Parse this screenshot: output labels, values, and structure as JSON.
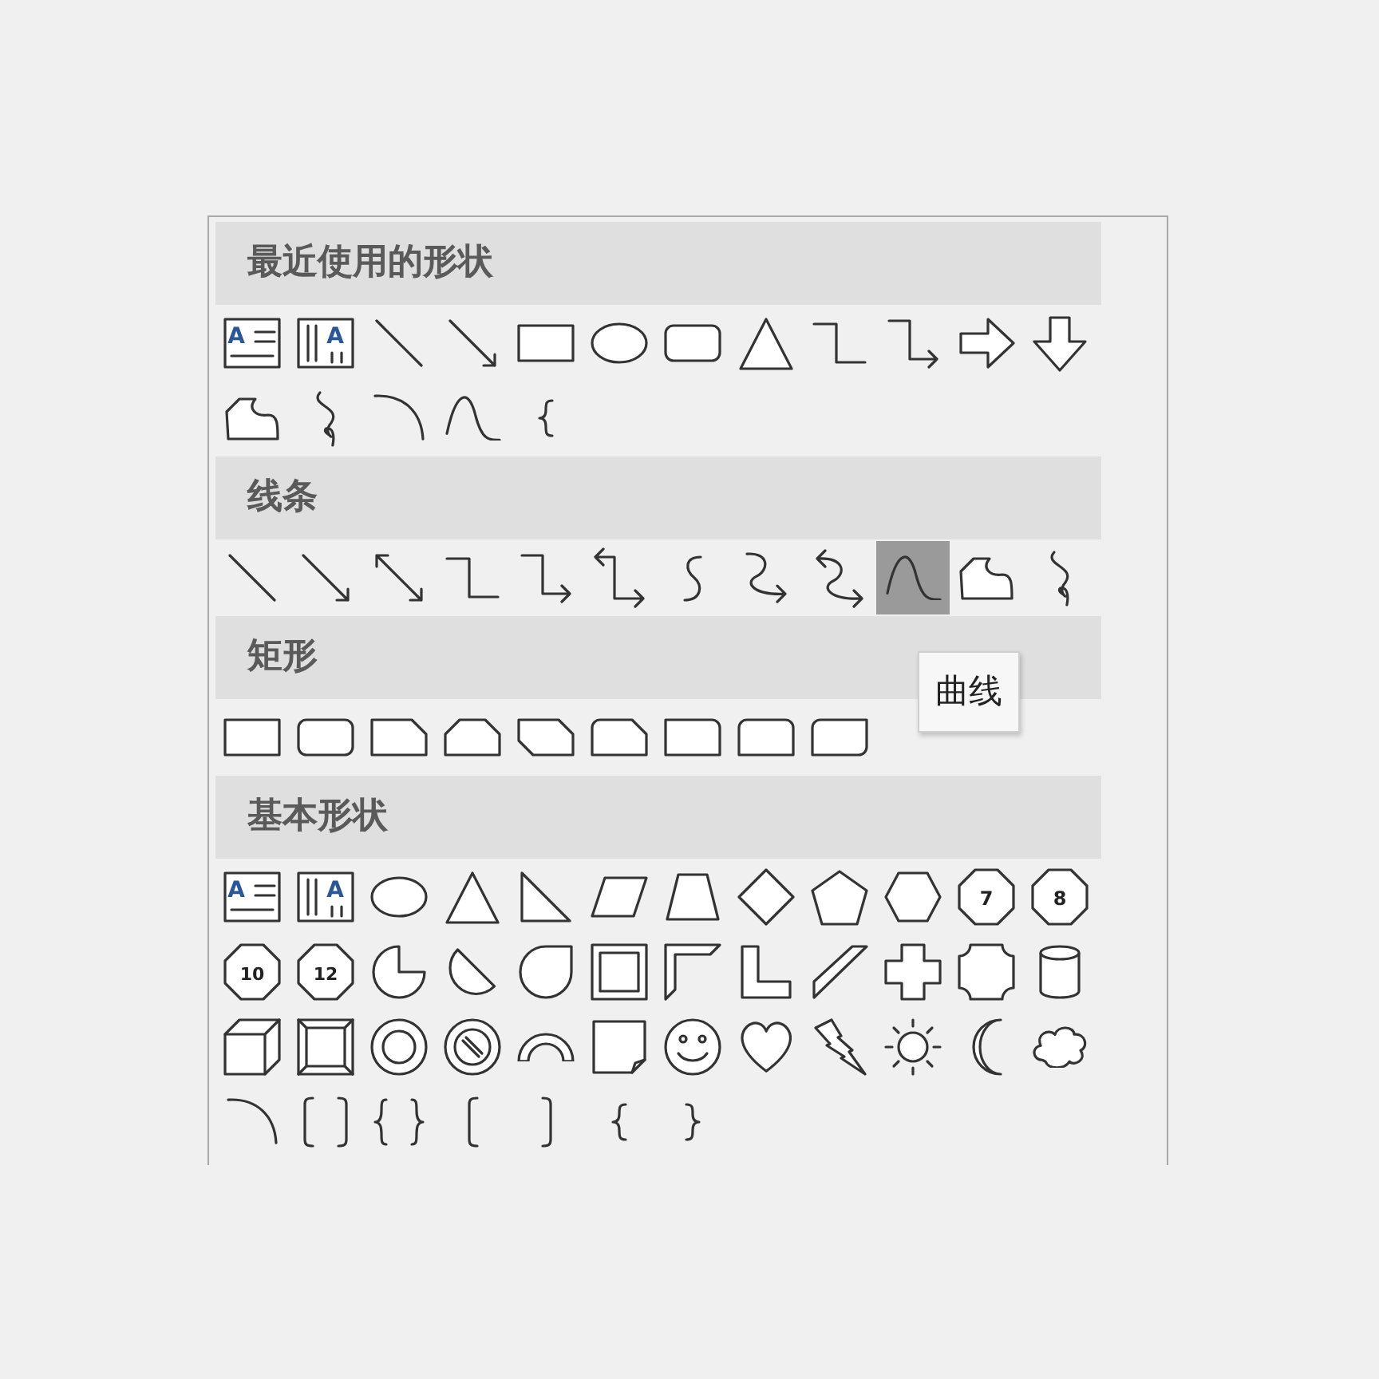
{
  "sections": [
    {
      "title": "最近使用的形状",
      "items": [
        {
          "kind": "text-box",
          "text": "A",
          "selected": false
        },
        {
          "kind": "vertical-text-box",
          "text": "A",
          "selected": false
        },
        {
          "kind": "line",
          "selected": false
        },
        {
          "kind": "arrow-line",
          "selected": false
        },
        {
          "kind": "rectangle",
          "selected": false
        },
        {
          "kind": "ellipse",
          "selected": false
        },
        {
          "kind": "rounded-rectangle",
          "selected": false
        },
        {
          "kind": "triangle",
          "selected": false
        },
        {
          "kind": "elbow-connector",
          "selected": false
        },
        {
          "kind": "elbow-arrow-connector",
          "selected": false
        },
        {
          "kind": "right-arrow",
          "selected": false
        },
        {
          "kind": "down-arrow",
          "selected": false
        },
        {
          "kind": "freeform",
          "selected": false
        },
        {
          "kind": "scribble",
          "selected": false
        },
        {
          "kind": "arc",
          "selected": false
        },
        {
          "kind": "curve",
          "selected": false
        },
        {
          "kind": "left-brace",
          "selected": false
        }
      ]
    },
    {
      "title": "线条",
      "items": [
        {
          "kind": "line",
          "selected": false
        },
        {
          "kind": "arrow-line",
          "selected": false
        },
        {
          "kind": "double-arrow-line",
          "selected": false
        },
        {
          "kind": "elbow-connector",
          "selected": false
        },
        {
          "kind": "elbow-arrow-connector",
          "selected": false
        },
        {
          "kind": "elbow-double-arrow-connector",
          "selected": false
        },
        {
          "kind": "curved-connector",
          "selected": false
        },
        {
          "kind": "curved-arrow-connector",
          "selected": false
        },
        {
          "kind": "curved-double-arrow-connector",
          "selected": false
        },
        {
          "kind": "curve",
          "selected": true
        },
        {
          "kind": "freeform",
          "selected": false
        },
        {
          "kind": "scribble",
          "selected": false
        }
      ]
    },
    {
      "title": "矩形",
      "items": [
        {
          "kind": "rectangle",
          "selected": false
        },
        {
          "kind": "rounded-rectangle",
          "selected": false
        },
        {
          "kind": "snip-corner-rectangle",
          "selected": false
        },
        {
          "kind": "snip-same-side-rectangle",
          "selected": false
        },
        {
          "kind": "snip-diagonal-rectangle",
          "selected": false
        },
        {
          "kind": "snip-round-rectangle",
          "selected": false
        },
        {
          "kind": "round-corner-rectangle",
          "selected": false
        },
        {
          "kind": "round-same-side-rectangle",
          "selected": false
        },
        {
          "kind": "round-diagonal-rectangle",
          "selected": false
        }
      ]
    },
    {
      "title": "基本形状",
      "items": [
        {
          "kind": "text-box",
          "text": "A",
          "selected": false
        },
        {
          "kind": "vertical-text-box",
          "text": "A",
          "selected": false
        },
        {
          "kind": "ellipse",
          "selected": false
        },
        {
          "kind": "triangle",
          "selected": false
        },
        {
          "kind": "right-triangle",
          "selected": false
        },
        {
          "kind": "parallelogram",
          "selected": false
        },
        {
          "kind": "trapezoid",
          "selected": false
        },
        {
          "kind": "diamond",
          "selected": false
        },
        {
          "kind": "pentagon",
          "selected": false
        },
        {
          "kind": "hexagon",
          "selected": false
        },
        {
          "kind": "heptagon",
          "text": "7",
          "selected": false
        },
        {
          "kind": "octagon",
          "text": "8",
          "selected": false
        },
        {
          "kind": "decagon",
          "text": "10",
          "selected": false
        },
        {
          "kind": "dodecagon",
          "text": "12",
          "selected": false
        },
        {
          "kind": "pie",
          "selected": false
        },
        {
          "kind": "chord",
          "selected": false
        },
        {
          "kind": "teardrop",
          "selected": false
        },
        {
          "kind": "frame",
          "selected": false
        },
        {
          "kind": "half-frame",
          "selected": false
        },
        {
          "kind": "l-shape",
          "selected": false
        },
        {
          "kind": "diagonal-stripe",
          "selected": false
        },
        {
          "kind": "cross",
          "selected": false
        },
        {
          "kind": "plaque",
          "selected": false
        },
        {
          "kind": "cylinder",
          "selected": false
        },
        {
          "kind": "cube",
          "selected": false
        },
        {
          "kind": "bevel",
          "selected": false
        },
        {
          "kind": "donut",
          "selected": false
        },
        {
          "kind": "no-symbol",
          "selected": false
        },
        {
          "kind": "block-arc",
          "selected": false
        },
        {
          "kind": "folded-corner",
          "selected": false
        },
        {
          "kind": "smiley",
          "selected": false
        },
        {
          "kind": "heart",
          "selected": false
        },
        {
          "kind": "lightning",
          "selected": false
        },
        {
          "kind": "sun",
          "selected": false
        },
        {
          "kind": "moon",
          "selected": false
        },
        {
          "kind": "cloud",
          "selected": false
        },
        {
          "kind": "arc",
          "selected": false
        },
        {
          "kind": "bracket-pair",
          "selected": false
        },
        {
          "kind": "brace-pair",
          "selected": false
        },
        {
          "kind": "left-bracket",
          "selected": false
        },
        {
          "kind": "right-bracket",
          "selected": false
        },
        {
          "kind": "left-brace",
          "selected": false
        },
        {
          "kind": "right-brace",
          "selected": false
        }
      ]
    }
  ],
  "tooltip": {
    "text": "曲线"
  }
}
